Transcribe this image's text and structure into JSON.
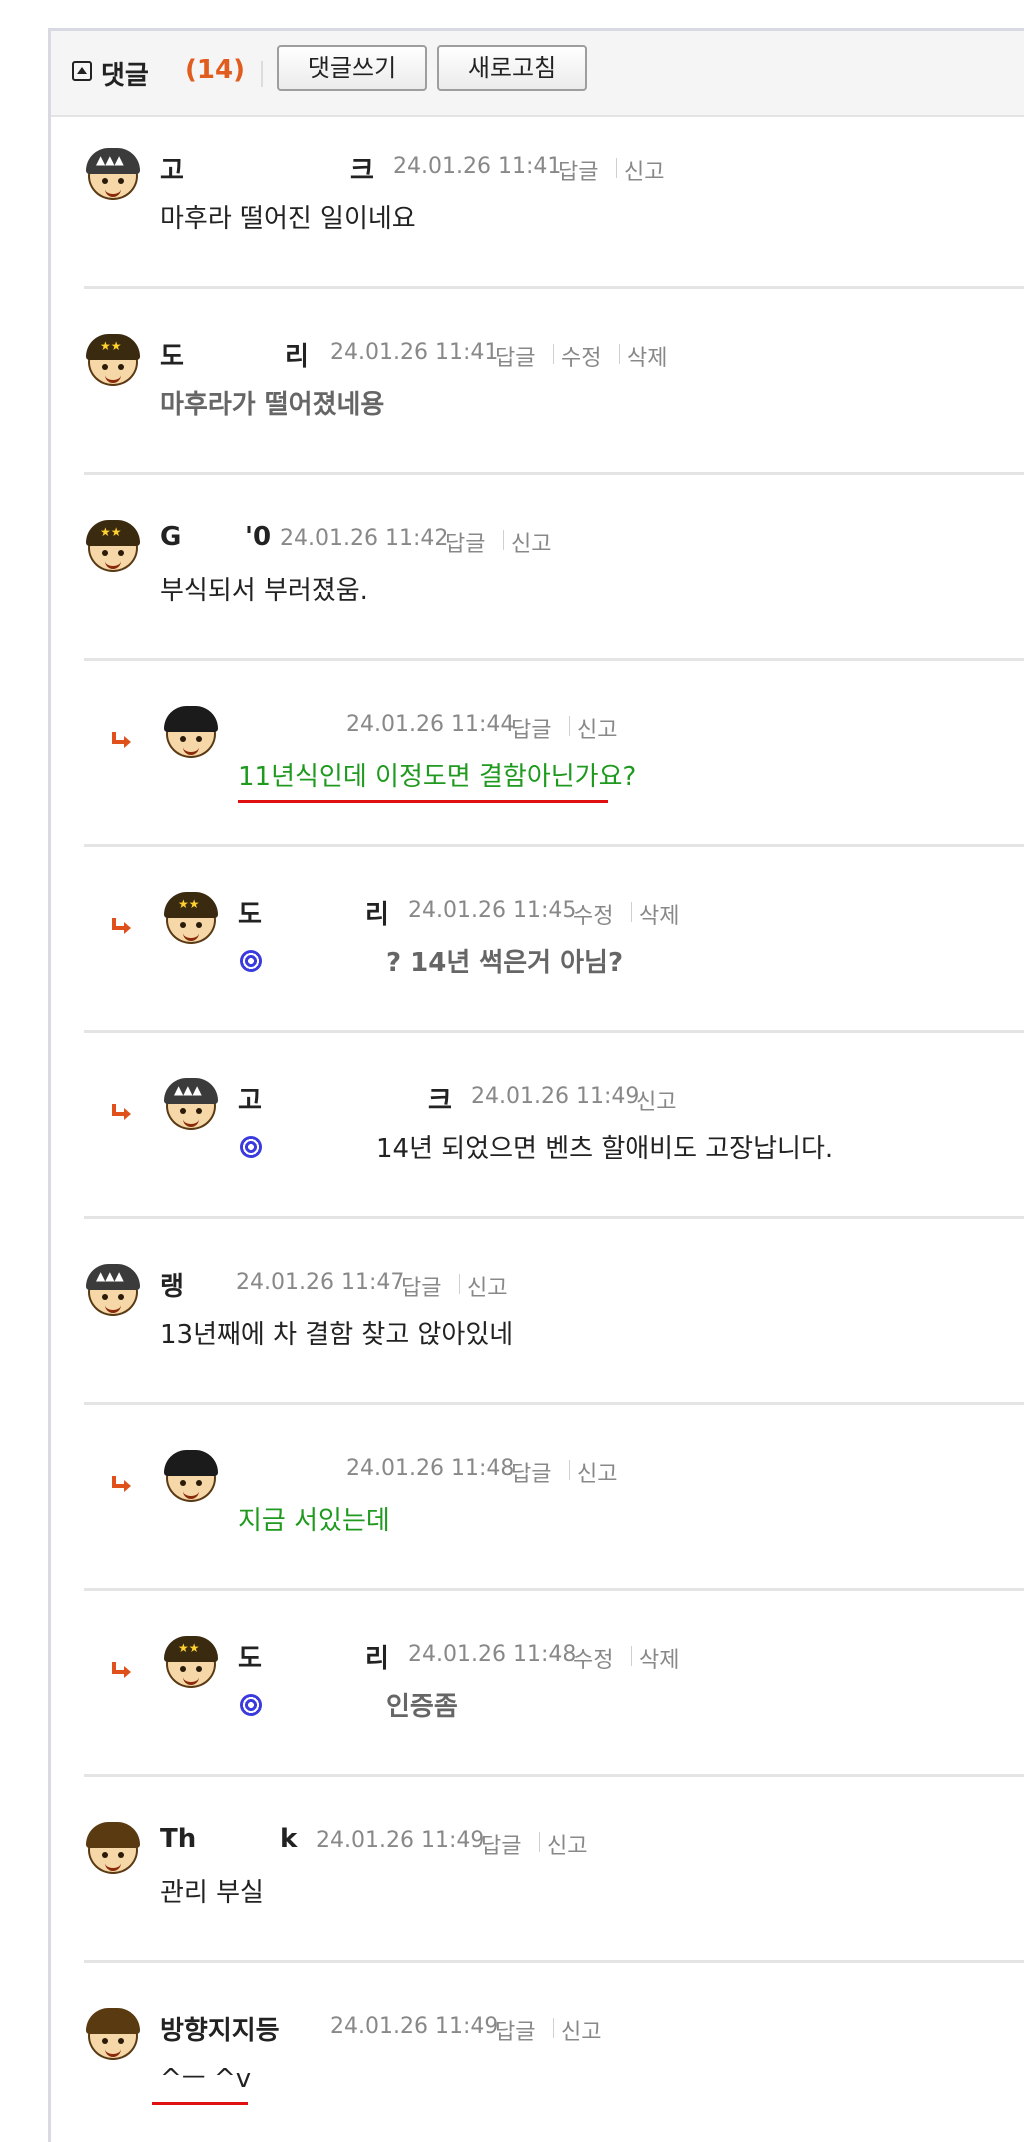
{
  "header": {
    "title": "댓글",
    "count": "(14)",
    "write_button": "댓글쓰기",
    "refresh_button": "새로고침"
  },
  "colors": {
    "count": "#e05c1f",
    "green_text": "#1f9a1f",
    "underline": "#e01010",
    "reply_arrow": "#e0501a"
  },
  "comments": [
    {
      "name": "고",
      "name_tail": "크",
      "date": "24.01.26 11:41",
      "actions": [
        "답글",
        "신고"
      ],
      "text": "마후라 떨어진 일이네요"
    },
    {
      "name": "도",
      "name_tail": "리",
      "date": "24.01.26 11:41",
      "actions": [
        "답글",
        "수정",
        "삭제"
      ],
      "text": "마후라가 떨어졌네용"
    },
    {
      "name": "G",
      "name_tail": "'0",
      "date": "24.01.26 11:42",
      "actions": [
        "답글",
        "신고"
      ],
      "text": "부식되서 부러졌움."
    },
    {
      "name": "",
      "name_tail": "",
      "date": "24.01.26 11:44",
      "actions": [
        "답글",
        "신고"
      ],
      "text": "11년식인데 이정도면 결함아닌가요?"
    },
    {
      "name": "도",
      "name_tail": "리",
      "date": "24.01.26 11:45",
      "actions": [
        "수정",
        "삭제"
      ],
      "text": "? 14년 썩은거 아님?"
    },
    {
      "name": "고",
      "name_tail": "크",
      "date": "24.01.26 11:49",
      "actions": [
        "신고"
      ],
      "text": "14년 되었으면 벤츠 할애비도 고장납니다."
    },
    {
      "name": "랭",
      "name_tail": "",
      "date": "24.01.26 11:47",
      "actions": [
        "답글",
        "신고"
      ],
      "text": "13년째에 차 결함 찾고 앉아있네"
    },
    {
      "name": "",
      "name_tail": "",
      "date": "24.01.26 11:48",
      "actions": [
        "답글",
        "신고"
      ],
      "text": "지금 서있는데"
    },
    {
      "name": "도",
      "name_tail": "리",
      "date": "24.01.26 11:48",
      "actions": [
        "수정",
        "삭제"
      ],
      "text": "인증좀"
    },
    {
      "name": "Th",
      "name_tail": "k",
      "date": "24.01.26 11:49",
      "actions": [
        "답글",
        "신고"
      ],
      "text": "관리 부실"
    },
    {
      "name": "방향지지등",
      "name_tail": "",
      "date": "24.01.26 11:49",
      "actions": [
        "답글",
        "신고"
      ],
      "text": "^ㅡ ^v"
    }
  ]
}
